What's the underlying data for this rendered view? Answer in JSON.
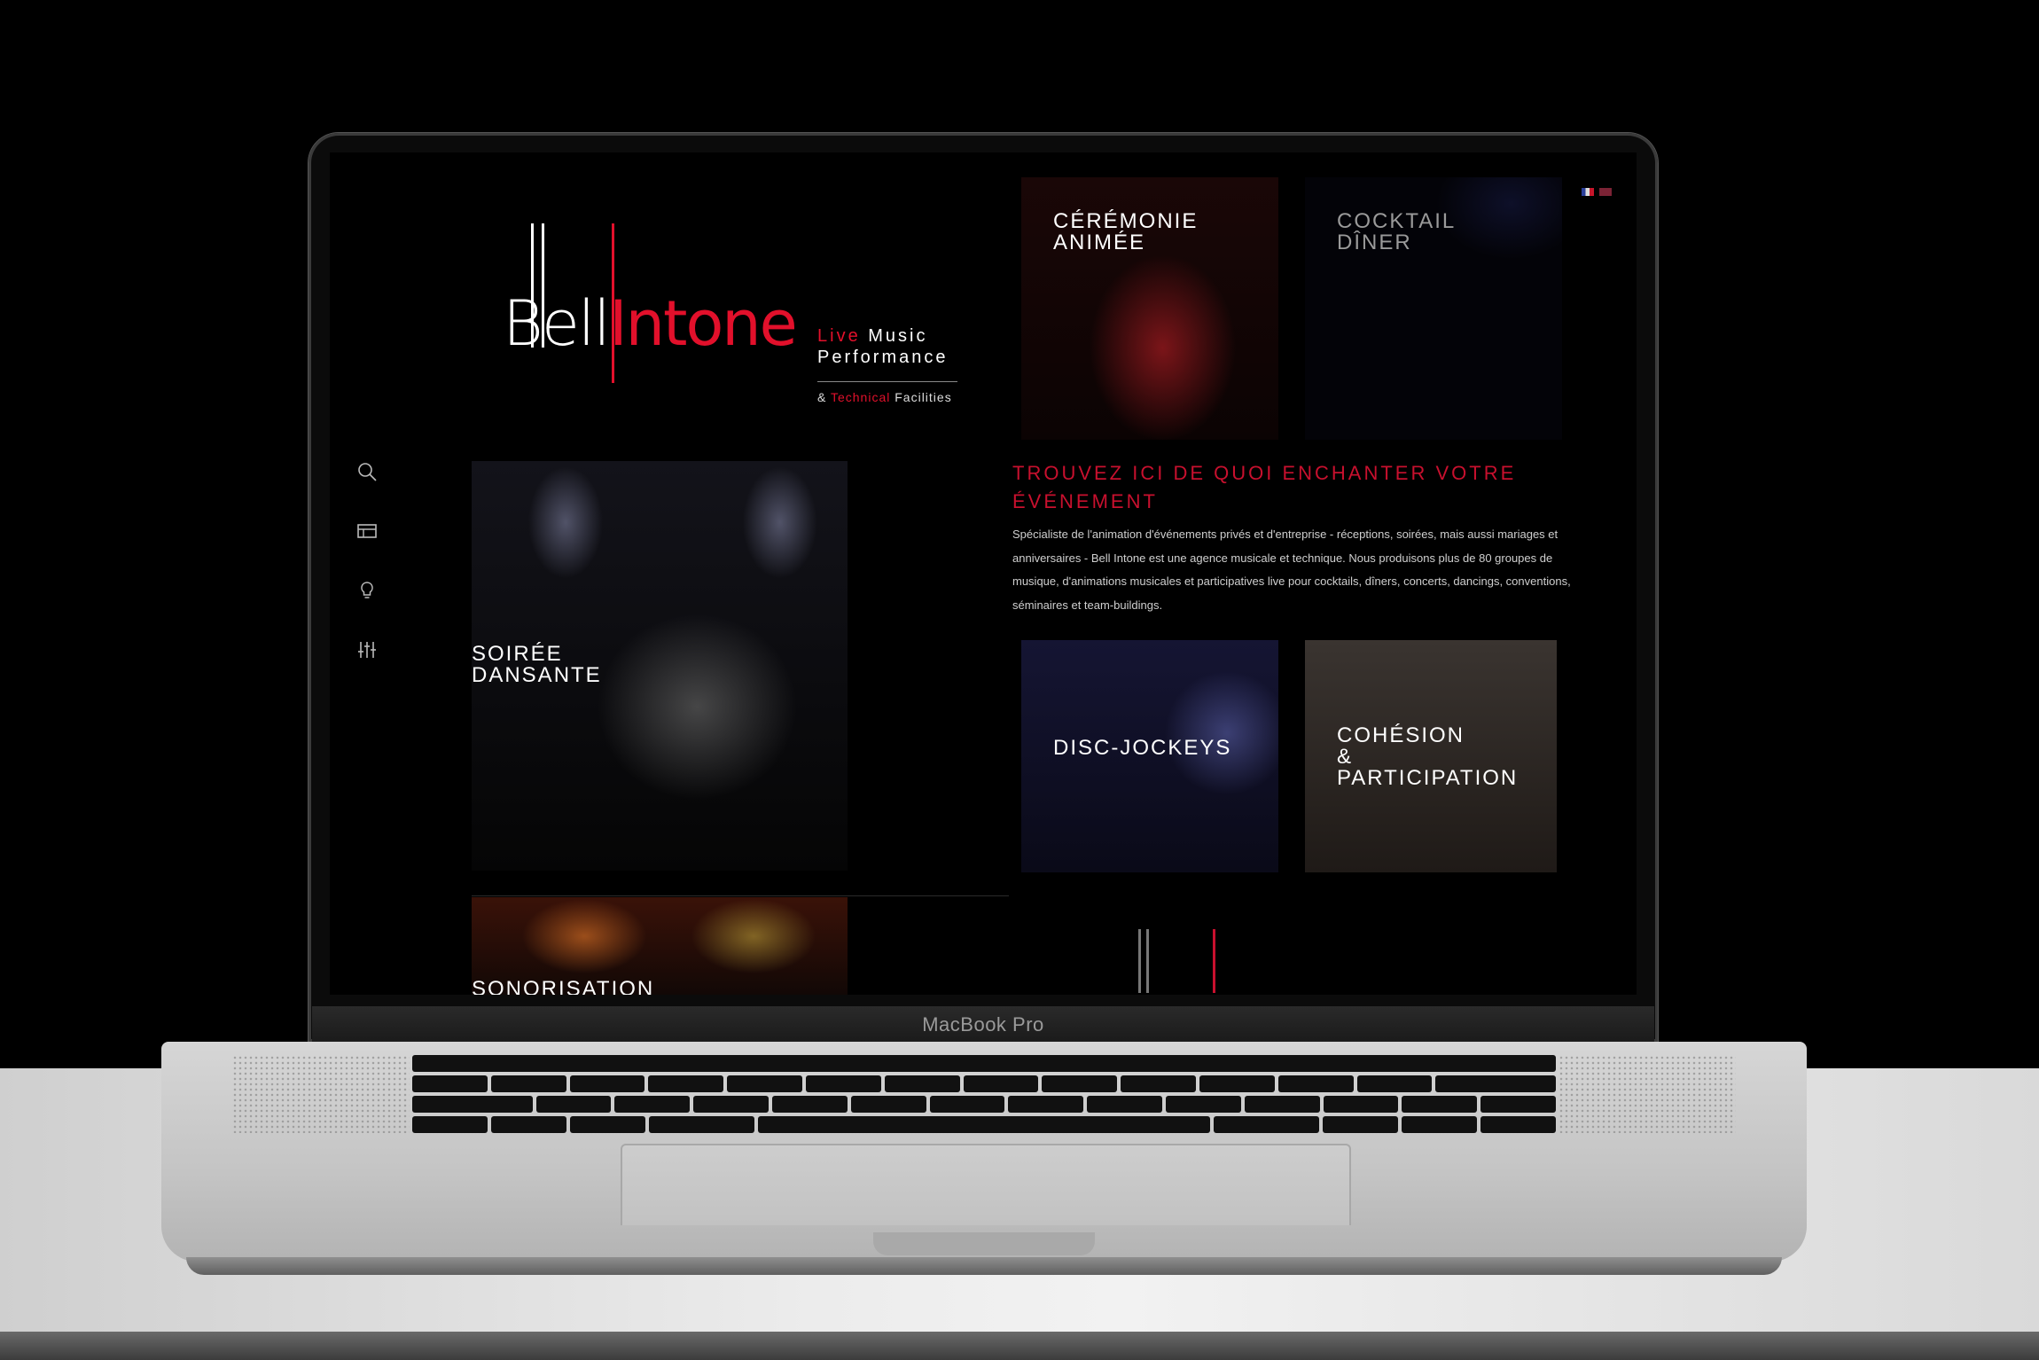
{
  "device": {
    "brand_label": "MacBook Pro"
  },
  "site": {
    "logo": {
      "word1": "Bell",
      "word2": "Intone"
    },
    "tagline": {
      "live": "Live",
      "music": "Music",
      "performance": "Performance",
      "amp": "&",
      "technical": "Technical",
      "facilities": "Facilities"
    },
    "nav": [
      {
        "icon": "search-icon"
      },
      {
        "icon": "catalog-icon"
      },
      {
        "icon": "lightbulb-icon"
      },
      {
        "icon": "equalizer-icon"
      }
    ],
    "tiles": {
      "soiree": {
        "line1": "SOIRÉE",
        "line2": "DANSANTE"
      },
      "ceremonie": {
        "line1": "CÉRÉMONIE",
        "line2": "ANIMÉE"
      },
      "cocktail": {
        "line1": "COCKTAIL",
        "line2": "DÎNER"
      },
      "disc": {
        "line1": "DISC-JOCKEYS"
      },
      "cohesion": {
        "line1": "COHÉSION",
        "line2": "&",
        "line3": "PARTICIPATION"
      },
      "sono": {
        "line1": "SONORISATION"
      }
    },
    "heading": "TROUVEZ ICI DE QUOI ENCHANTER VOTRE ÉVÉNEMENT",
    "intro": "Spécialiste de l'animation d'événements privés et d'entreprise - réceptions, soirées, mais aussi mariages et anniversaires - Bell Intone est une agence musicale et technique. Nous produisons plus de 80 groupes de musique, d'animations musicales et participatives live pour cocktails, dîners, concerts, dancings, conventions, séminaires et team-buildings.",
    "colors": {
      "accent": "#e2102b",
      "background": "#000000",
      "text": "#ffffff"
    }
  }
}
